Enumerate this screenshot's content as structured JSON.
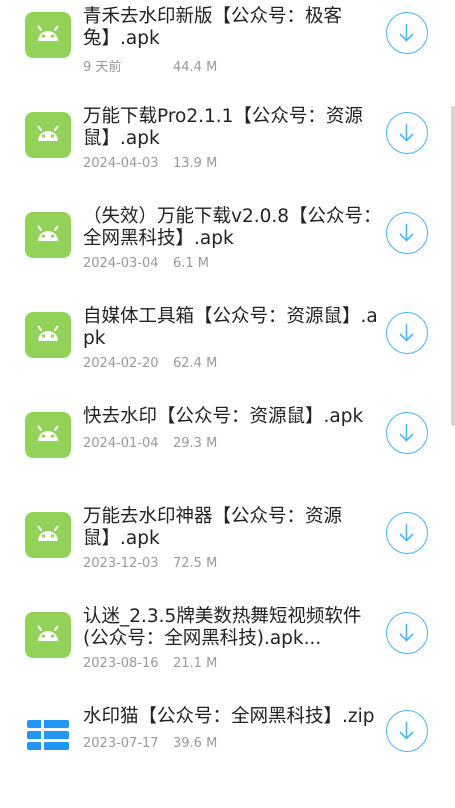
{
  "colors": {
    "apk_icon": "#92d258",
    "zip_icon": "#2196f3",
    "download_accent": "#4db4f0"
  },
  "files": [
    {
      "name": "青禾去水印新版【公众号：极客兔】.apk",
      "date": "9 天前",
      "size": "44.4 M",
      "icon": "android-icon"
    },
    {
      "name": "万能下载Pro2.1.1【公众号：资源鼠】.apk",
      "date": "2024-04-03",
      "size": "13.9 M",
      "icon": "android-icon"
    },
    {
      "name": "（失效）万能下载v2.0.8【公众号：全网黑科技】.apk",
      "date": "2024-03-04",
      "size": "6.1 M",
      "icon": "android-icon"
    },
    {
      "name": "自媒体工具箱【公众号：资源鼠】.apk",
      "date": "2024-02-20",
      "size": "62.4 M",
      "icon": "android-icon"
    },
    {
      "name": "快去水印【公众号：资源鼠】.apk",
      "date": "2024-01-04",
      "size": "29.3 M",
      "icon": "android-icon"
    },
    {
      "name": "万能去水印神器【公众号：资源鼠】.apk",
      "date": "2023-12-03",
      "size": "72.5 M",
      "icon": "android-icon"
    },
    {
      "name": "认迷_2.3.5牌美数热舞短视频软件(公众号：全网黑科技).apk...",
      "date": "2023-08-16",
      "size": "21.1 M",
      "icon": "android-icon"
    },
    {
      "name": "水印猫【公众号：全网黑科技】.zip",
      "date": "2023-07-17",
      "size": "39.6 M",
      "icon": "zip-archive-icon"
    }
  ]
}
